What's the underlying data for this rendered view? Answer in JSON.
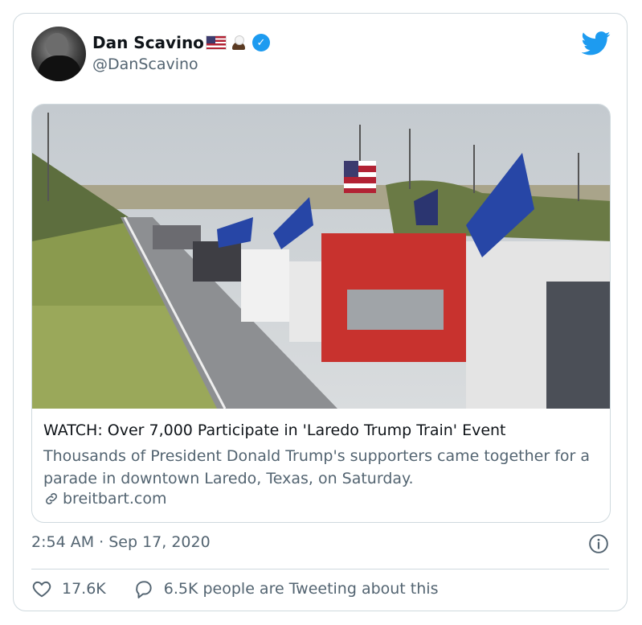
{
  "author": {
    "name": "Dan Scavino",
    "emoji": "🇺🇸🦅",
    "handle": "@DanScavino",
    "verified": true
  },
  "card": {
    "title": "WATCH: Over 7,000 Participate in 'Laredo Trump Train' Event",
    "description": "Thousands of President Donald Trump's supporters came together for a parade in downtown Laredo, Texas, on Saturday.",
    "domain": "breitbart.com"
  },
  "timestamp": "2:54 AM · Sep 17, 2020",
  "stats": {
    "likes": "17.6K",
    "tweeting": "6.5K people are Tweeting about this"
  },
  "colors": {
    "accent": "#1d9bf0",
    "text": "#0f1419",
    "muted": "#536471",
    "border": "#cfd9de"
  },
  "icons": [
    "twitter-bird-icon",
    "verified-badge-icon",
    "link-icon",
    "info-icon",
    "heart-icon",
    "reply-bubble-icon"
  ]
}
